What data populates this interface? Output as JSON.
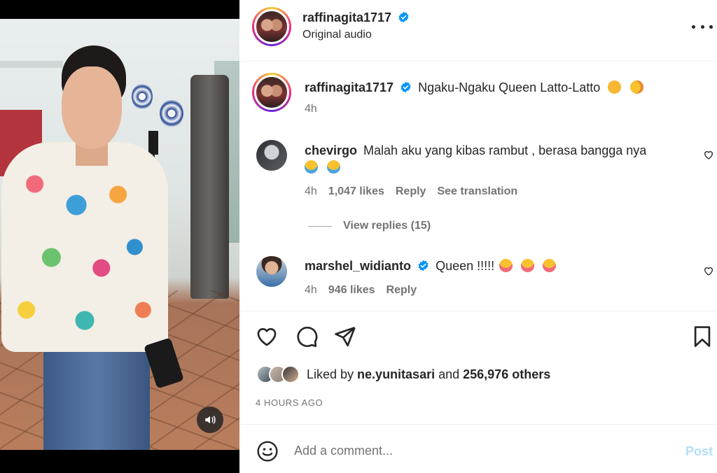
{
  "post": {
    "author": "raffinagita1717",
    "audio": "Original audio",
    "caption": "Ngaku-Ngaku Queen Latto-Latto",
    "caption_age": "4h",
    "timestamp": "4 HOURS AGO"
  },
  "comments": [
    {
      "username": "chevirgo",
      "text": "Malah aku yang kibas rambut , berasa bangga nya",
      "age": "4h",
      "likes": "1,047 likes",
      "reply_label": "Reply",
      "translate_label": "See translation",
      "view_replies": "View replies (15)"
    },
    {
      "username": "marshel_widianto",
      "text": "Queen !!!!!",
      "age": "4h",
      "likes": "946 likes",
      "reply_label": "Reply"
    }
  ],
  "likes_summary": {
    "prefix": "Liked by",
    "first_user": "ne.yunitasari",
    "middle": "and",
    "others": "256,976 others"
  },
  "comment_box": {
    "placeholder": "Add a comment...",
    "post_label": "Post"
  },
  "icons": [
    "verified-badge-icon",
    "more-options-icon",
    "heart-icon",
    "comment-icon",
    "share-icon",
    "bookmark-icon",
    "emoji-icon",
    "sound-icon"
  ],
  "colors": {
    "verified": "#0095f6",
    "muted": "#737373",
    "post_button": "#b2dffc"
  }
}
